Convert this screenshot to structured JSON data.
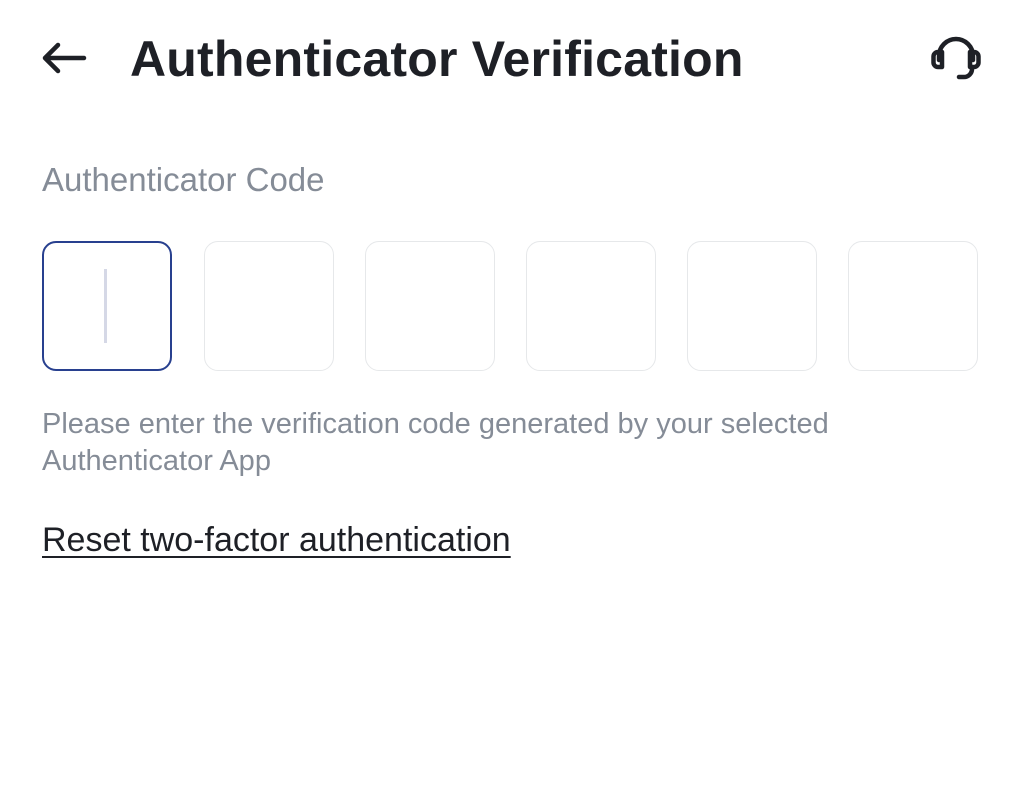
{
  "header": {
    "title": "Authenticator Verification",
    "back_icon": "arrow-left-icon",
    "support_icon": "headset-icon"
  },
  "form": {
    "label": "Authenticator Code",
    "code_digits": [
      "",
      "",
      "",
      "",
      "",
      ""
    ],
    "active_index": 0,
    "helper_text": "Please enter the verification code generated by your selected Authenticator App",
    "reset_link": "Reset two-factor authentication"
  },
  "colors": {
    "title": "#1e2026",
    "muted_text": "#858c97",
    "active_border": "#28408f",
    "inactive_border": "#e6e8ea"
  }
}
